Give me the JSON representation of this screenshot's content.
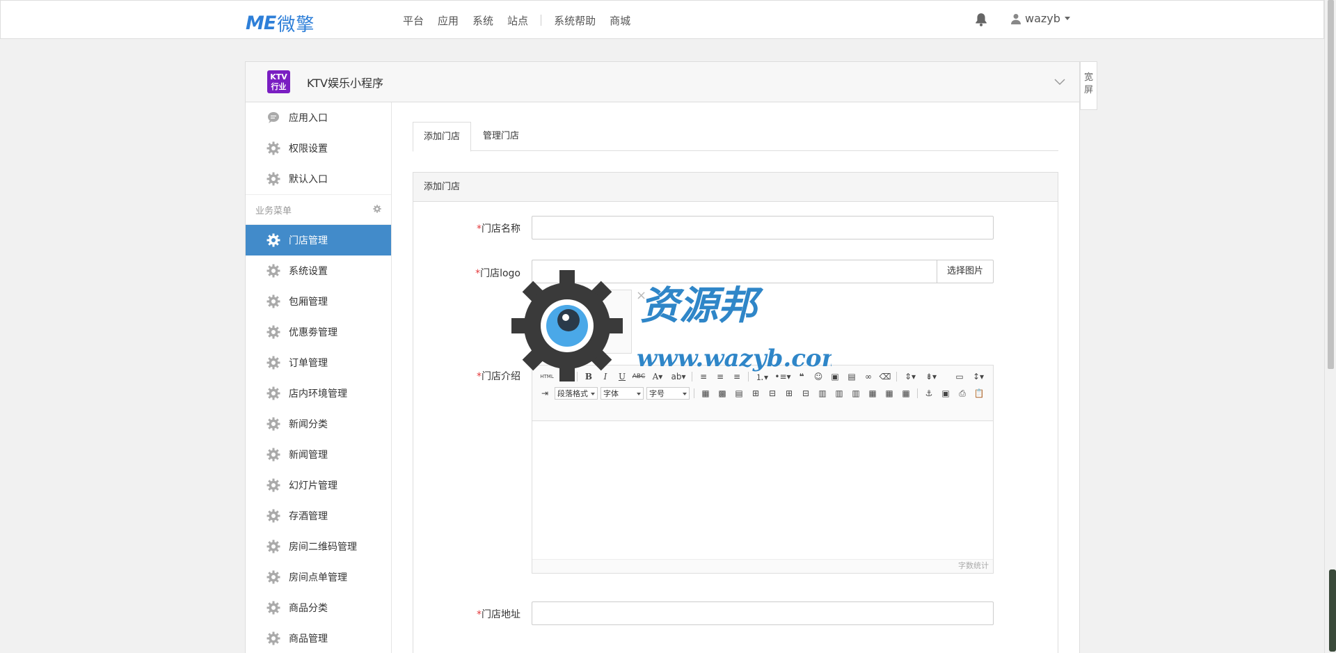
{
  "brand": {
    "mark": "ME",
    "name": "微擎"
  },
  "nav": [
    "平台",
    "应用",
    "系统",
    "站点",
    "系统帮助",
    "商城"
  ],
  "user": {
    "name": "wazyb"
  },
  "wide_toggle": {
    "line1": "宽",
    "line2": "屏"
  },
  "app": {
    "icon_line1": "KTV",
    "icon_line2": "行业",
    "title": "KTV娱乐小程序",
    "icon_color": "#7a1ec2"
  },
  "sidebar": {
    "top_items": [
      "应用入口",
      "权限设置",
      "默认入口"
    ],
    "section_title": "业务菜单",
    "items": [
      "门店管理",
      "系统设置",
      "包厢管理",
      "优惠劵管理",
      "订单管理",
      "店内环境管理",
      "新闻分类",
      "新闻管理",
      "幻灯片管理",
      "存酒管理",
      "房间二维码管理",
      "房间点单管理",
      "商品分类",
      "商品管理"
    ],
    "active_index": 0,
    "active_color": "#428bca"
  },
  "tabs": [
    "添加门店",
    "管理门店"
  ],
  "form": {
    "card_title": "添加门店",
    "required_mark": "*",
    "name_label": "门店名称",
    "logo_label": "门店logo",
    "logo_button": "选择图片",
    "thumb_close": "×",
    "intro_label": "门店介绍",
    "address_label": "门店地址",
    "editor": {
      "html_btn": "HTML",
      "paragraph_select": "段落格式",
      "font_select": "字体",
      "size_select": "字号",
      "word_count": "字数统计"
    }
  },
  "watermark": {
    "title": "资源邦",
    "url": "www.wazyb.com"
  }
}
